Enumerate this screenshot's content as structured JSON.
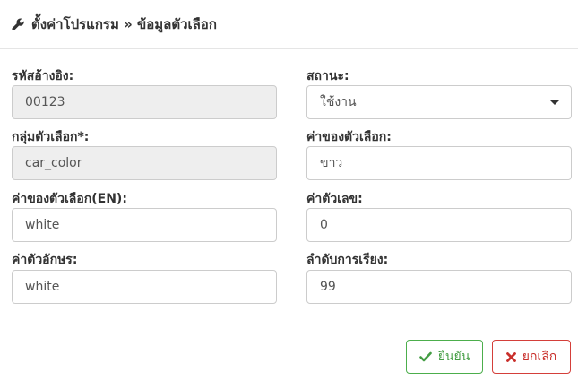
{
  "header": {
    "icon": "wrench-icon",
    "title": "ตั้งค่าโปรแกรม » ข้อมูลตัวเลือก"
  },
  "form": {
    "ref_code": {
      "label": "รหัสอ้างอิง:",
      "value": "00123"
    },
    "status": {
      "label": "สถานะ:",
      "value": "ใช้งาน"
    },
    "option_group": {
      "label": "กลุ่มตัวเลือก*:",
      "value": "car_color"
    },
    "option_value": {
      "label": "ค่าของตัวเลือก:",
      "value": "ขาว"
    },
    "option_value_en": {
      "label": "ค่าของตัวเลือก(EN):",
      "value": "white"
    },
    "numeric_value": {
      "label": "ค่าตัวเลข:",
      "value": "0"
    },
    "char_value": {
      "label": "ค่าตัวอักษร:",
      "value": "white"
    },
    "sort_order": {
      "label": "ลำดับการเรียง:",
      "value": "99"
    }
  },
  "buttons": {
    "confirm": {
      "label": "ยืนยัน",
      "icon": "check-icon",
      "color": "#449d44"
    },
    "cancel": {
      "label": "ยกเลิก",
      "icon": "close-icon",
      "color": "#c9302c"
    }
  }
}
